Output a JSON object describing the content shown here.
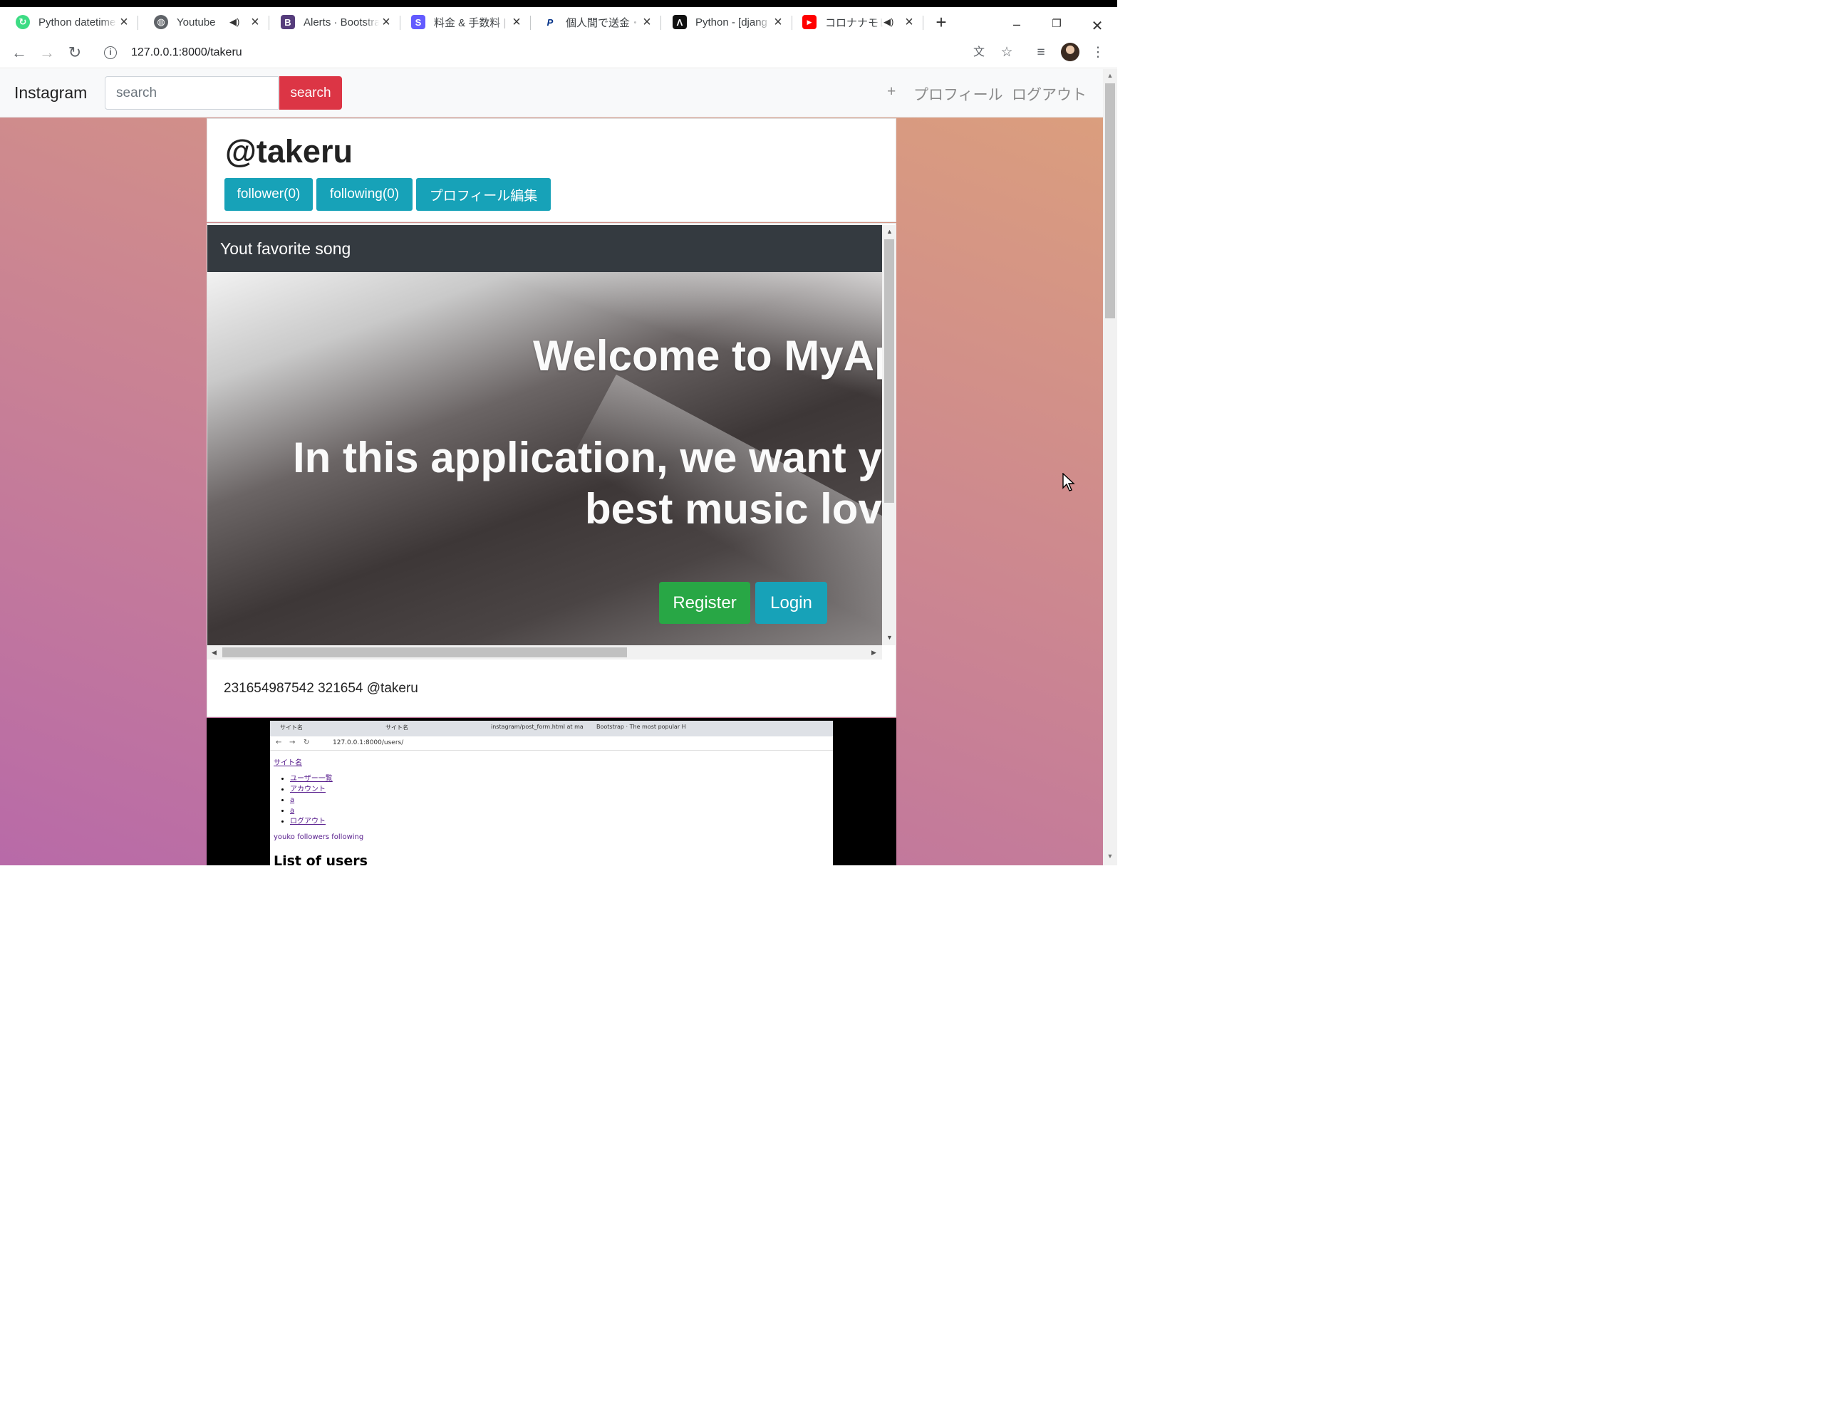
{
  "browser": {
    "tabs": [
      {
        "title": "Python datetime",
        "favicon": "refresh-green-icon",
        "color": "#3ddc84"
      },
      {
        "title": "Youtube",
        "favicon": "globe-icon",
        "color": "#5f6368",
        "active": true,
        "audio": true
      },
      {
        "title": "Alerts · Bootstrap",
        "favicon": "B",
        "color": "#563d7c"
      },
      {
        "title": "料金 & 手数料 |",
        "favicon": "S",
        "color": "#635bff"
      },
      {
        "title": "個人間で送金・集",
        "favicon": "P",
        "color": "#003087"
      },
      {
        "title": "Python - [djang",
        "favicon": "A",
        "color": "#111111"
      },
      {
        "title": "コロナナモレモ",
        "favicon": "youtube-icon",
        "color": "#ff0000",
        "audio": true
      }
    ],
    "url": "127.0.0.1:8000/takeru"
  },
  "navbar": {
    "brand": "Instagram",
    "search_placeholder": "search",
    "search_button": "search",
    "plus": "+",
    "profile_link": "プロフィール",
    "logout_link": "ログアウト"
  },
  "profile": {
    "username": "@takeru",
    "follower_button": "follower(0)",
    "following_button": "following(0)",
    "edit_button": "プロフィール編集"
  },
  "song_post": {
    "header": "Yout favorite song",
    "embed": {
      "welcome": "Welcome to MyApp",
      "line1": "In this application, we want you",
      "line2": "best music lover",
      "register": "Register",
      "login": "Login"
    },
    "caption": "231654987542 321654 @takeru"
  },
  "image_post": {
    "mini_tabs": [
      "サイト名",
      "サイト名",
      "instagram/post_form.html at ma",
      "Bootstrap · The most popular H"
    ],
    "mini_url": "127.0.0.1:8000/users/",
    "site_name": "サイト名",
    "links": [
      "ユーザー一覧",
      "アカウント",
      "a",
      "a",
      "ログアウト"
    ],
    "follow_line": "youko followers following",
    "heading": "List of users"
  },
  "colors": {
    "danger": "#dc3545",
    "info": "#17a2b8",
    "success": "#28a745",
    "dark": "#343a40"
  }
}
